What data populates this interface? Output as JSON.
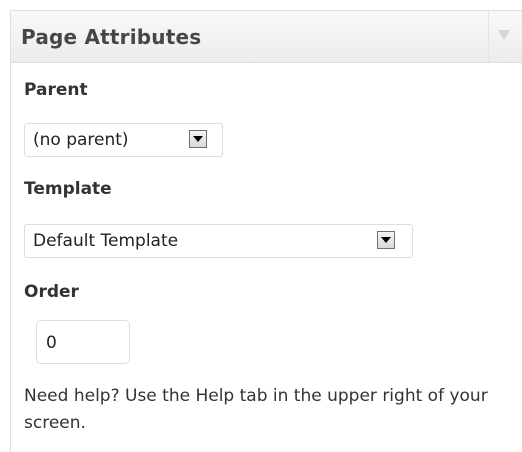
{
  "panel": {
    "title": "Page Attributes"
  },
  "parent": {
    "label": "Parent",
    "selected": "(no parent)"
  },
  "template": {
    "label": "Template",
    "selected": "Default Template"
  },
  "order": {
    "label": "Order",
    "value": "0"
  },
  "help": {
    "text": "Need help? Use the Help tab in the upper right of your screen."
  },
  "icons": {
    "collapse": "chevron-down-icon",
    "dropdown": "dropdown-arrow-icon"
  },
  "colors": {
    "header_bg": "#ececec",
    "border": "#dfdfdf",
    "text": "#333333"
  }
}
